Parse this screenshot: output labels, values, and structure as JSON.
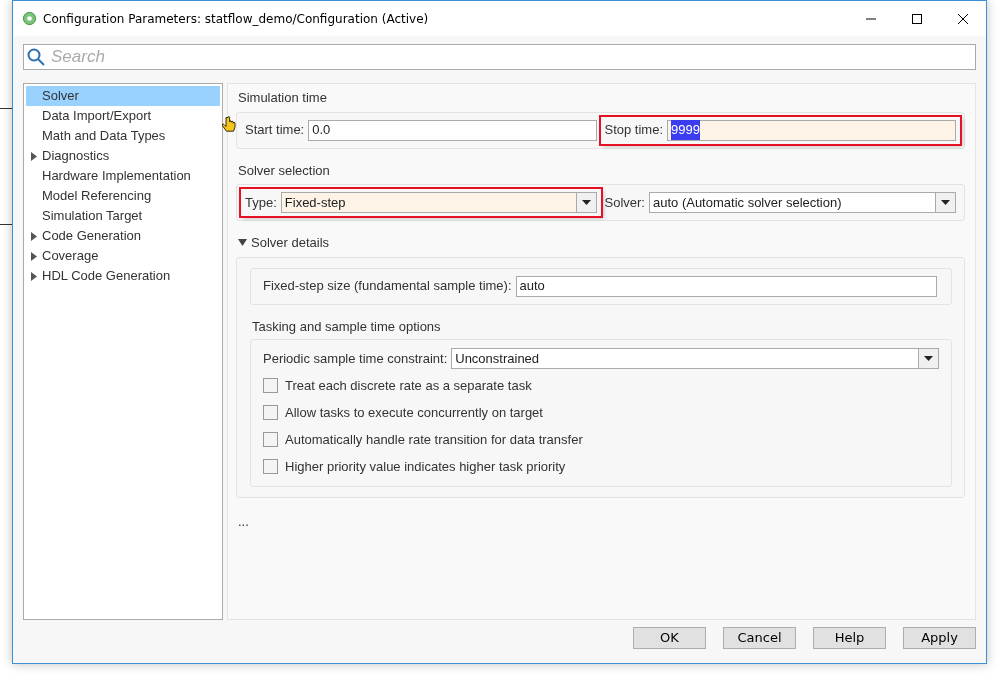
{
  "window": {
    "title": "Configuration Parameters: statflow_demo/Configuration (Active)"
  },
  "search": {
    "placeholder": "Search"
  },
  "tree": [
    {
      "label": "Solver",
      "selected": true,
      "expandable": false
    },
    {
      "label": "Data Import/Export",
      "selected": false,
      "expandable": false
    },
    {
      "label": "Math and Data Types",
      "selected": false,
      "expandable": false
    },
    {
      "label": "Diagnostics",
      "selected": false,
      "expandable": true
    },
    {
      "label": "Hardware Implementation",
      "selected": false,
      "expandable": false
    },
    {
      "label": "Model Referencing",
      "selected": false,
      "expandable": false
    },
    {
      "label": "Simulation Target",
      "selected": false,
      "expandable": false
    },
    {
      "label": "Code Generation",
      "selected": false,
      "expandable": true
    },
    {
      "label": "Coverage",
      "selected": false,
      "expandable": true
    },
    {
      "label": "HDL Code Generation",
      "selected": false,
      "expandable": true
    }
  ],
  "simulation_time": {
    "title": "Simulation time",
    "fields": [
      {
        "label": "Start time:",
        "value": "0.0",
        "highlighted": false,
        "value_selected": false
      },
      {
        "label": "Stop time:",
        "value": "9999",
        "highlighted": true,
        "value_selected": true
      }
    ]
  },
  "solver_selection": {
    "title": "Solver selection",
    "dropdowns": [
      {
        "label": "Type:",
        "value": "Fixed-step",
        "highlighted": true
      },
      {
        "label": "Solver:",
        "value": "auto (Automatic solver selection)",
        "highlighted": false
      }
    ]
  },
  "solver_details": {
    "title": "Solver details",
    "expanded": true,
    "step_size": {
      "label": "Fixed-step size (fundamental sample time):",
      "value": "auto"
    },
    "tasking": {
      "title": "Tasking and sample time options",
      "constraint": {
        "label": "Periodic sample time constraint:",
        "value": "Unconstrained"
      },
      "options": [
        {
          "label": "Treat each discrete rate as a separate task",
          "checked": false
        },
        {
          "label": "Allow tasks to execute concurrently on target",
          "checked": false
        },
        {
          "label": "Automatically handle rate transition for data transfer",
          "checked": false
        },
        {
          "label": "Higher priority value indicates higher task priority",
          "checked": false
        }
      ]
    }
  },
  "more": "...",
  "buttons": [
    "OK",
    "Cancel",
    "Help",
    "Apply"
  ]
}
